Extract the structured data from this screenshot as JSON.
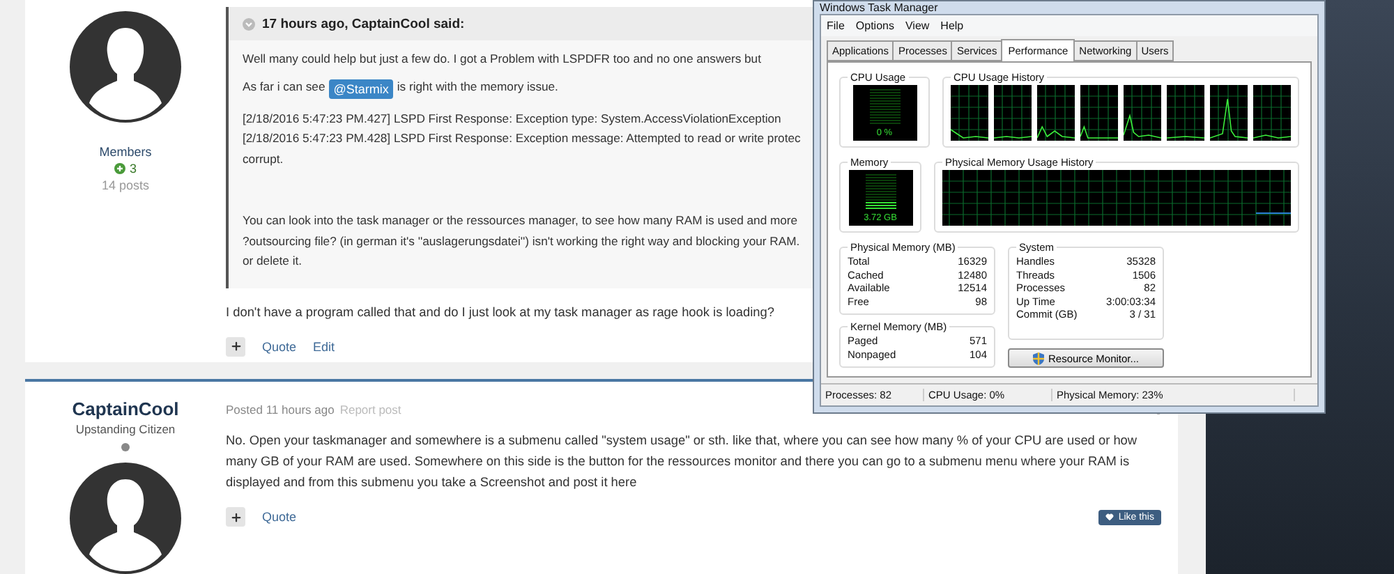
{
  "forum": {
    "posts": [
      {
        "author": {
          "group": "Members",
          "reputation": "3",
          "post_count": "14 posts"
        },
        "quote": {
          "header": "17 hours ago, CaptainCool said:",
          "paragraphs": [
            {
              "kind": "text",
              "lines": [
                "Well many could help but just a few do. I got a Problem with LSPDFR too and no one answers but"
              ]
            },
            {
              "kind": "mention",
              "before": "As far i can see",
              "mention": "@Starmix",
              "after": "is right with the memory issue."
            },
            {
              "kind": "log",
              "lines": [
                "[2/18/2016 5:47:23 PM.427] LSPD First Response: Exception type: System.AccessViolationException",
                "[2/18/2016 5:47:23 PM.428] LSPD First Response: Exception message: Attempted to read or write protec",
                "corrupt."
              ]
            },
            {
              "kind": "text",
              "lines": [
                "You can look into the task manager or the ressources manager, to see how many RAM is used and more",
                "?outsourcing file? (in german it's ''auslagerungsdatei'') isn't working the right way and blocking your RAM.",
                "or delete it."
              ]
            }
          ]
        },
        "body": "I don't have a program called that and  do I just look at my task manager as rage hook is loading?",
        "actions": [
          "Quote",
          "Edit"
        ]
      },
      {
        "author": {
          "name": "CaptainCool",
          "title": "Upstanding Citizen",
          "online": false
        },
        "meta": {
          "posted": "Posted 11 hours ago",
          "report": "Report post"
        },
        "body": "No. Open your taskmanager and somewhere is a submenu called \"system usage\" or sth. like that, where you can see how many % of your CPU are used or how many GB of your RAM are used. Somewhere on this side is the button for the ressources monitor and there you can go to a submenu menu where your RAM is displayed and from this submenu you take a Screenshot and post it here",
        "actions": [
          "Quote"
        ],
        "like": "Like this"
      }
    ]
  },
  "task_manager": {
    "title": "Windows Task Manager",
    "menu": [
      "File",
      "Options",
      "View",
      "Help"
    ],
    "tabs": [
      {
        "label": "Applications",
        "selected": false
      },
      {
        "label": "Processes",
        "selected": false
      },
      {
        "label": "Services",
        "selected": false
      },
      {
        "label": "Performance",
        "selected": true
      },
      {
        "label": "Networking",
        "selected": false
      },
      {
        "label": "Users",
        "selected": false
      }
    ],
    "cpu_usage": {
      "label": "CPU Usage",
      "reading": "0 %",
      "level": 0
    },
    "cpu_history": {
      "label": "CPU Usage History"
    },
    "memory": {
      "label": "Memory",
      "reading": "3.72 GB",
      "level": 0.23
    },
    "memory_history": {
      "label": "Physical Memory Usage History"
    },
    "physical_memory": {
      "label": "Physical Memory (MB)",
      "rows": [
        {
          "name": "Total",
          "value": "16329"
        },
        {
          "name": "Cached",
          "value": "12480"
        },
        {
          "name": "Available",
          "value": "12514"
        },
        {
          "name": "Free",
          "value": "98"
        }
      ]
    },
    "kernel_memory": {
      "label": "Kernel Memory (MB)",
      "rows": [
        {
          "name": "Paged",
          "value": "571"
        },
        {
          "name": "Nonpaged",
          "value": "104"
        }
      ]
    },
    "system": {
      "label": "System",
      "rows": [
        {
          "name": "Handles",
          "value": "35328"
        },
        {
          "name": "Threads",
          "value": "1506"
        },
        {
          "name": "Processes",
          "value": "82"
        },
        {
          "name": "Up Time",
          "value": "3:00:03:34"
        },
        {
          "name": "Commit (GB)",
          "value": "3 / 31"
        }
      ]
    },
    "resource_button": "Resource Monitor...",
    "status_bar": [
      "Processes: 82",
      "CPU Usage: 0%",
      "Physical Memory: 23%"
    ]
  }
}
